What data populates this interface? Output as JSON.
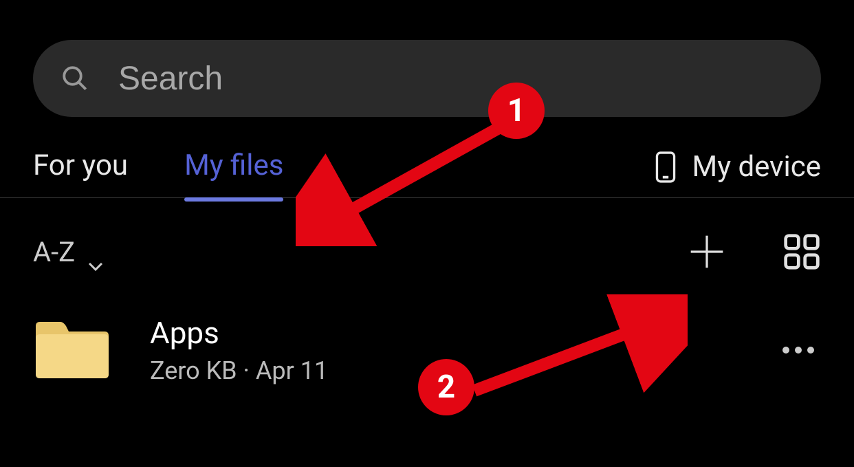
{
  "search": {
    "placeholder": "Search"
  },
  "tabs": {
    "for_you": "For you",
    "my_files": "My files"
  },
  "device_link": {
    "label": "My device"
  },
  "sort": {
    "label": "A-Z"
  },
  "files": [
    {
      "name": "Apps",
      "size": "Zero KB",
      "date": "Apr 11"
    }
  ],
  "annotations": {
    "badge1": "1",
    "badge2": "2"
  },
  "colors": {
    "accent": "#5562d6",
    "annotation": "#e30613"
  }
}
